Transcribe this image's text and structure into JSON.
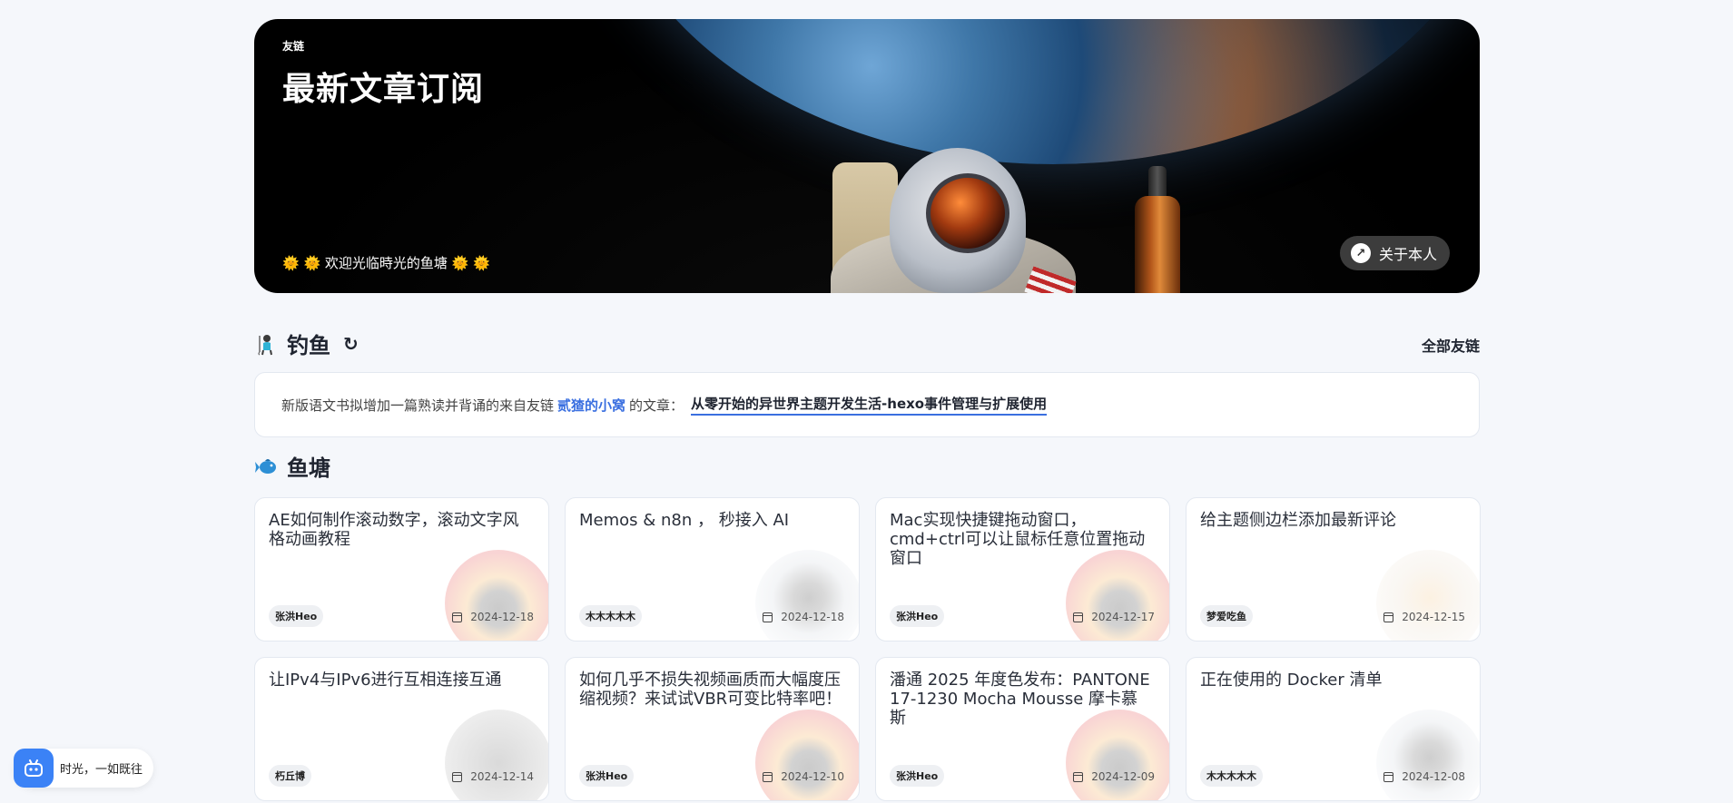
{
  "banner": {
    "small_label": "友链",
    "title": "最新文章订阅",
    "welcome": "🌞 🌞 欢迎光临時光的鱼塘 🌞 🌞",
    "about_button": "关于本人"
  },
  "fishing": {
    "heading": "钓鱼",
    "all_links": "全部友链",
    "notice_prefix": "新版语文书拟增加一篇熟读并背诵的来自友链",
    "notice_author": "贰猹的小窝",
    "notice_middle": "的文章：",
    "notice_article": "从零开始的异世界主题开发生活-hexo事件管理与扩展使用"
  },
  "pond": {
    "heading": "鱼塘",
    "cards": [
      {
        "title": "AE如何制作滚动数字，滚动文字风格动画教程",
        "author": "张洪Heo",
        "date": "2024-12-18",
        "avatar": "heo"
      },
      {
        "title": "Memos & n8n ， 秒接入 AI",
        "author": "木木木木木",
        "date": "2024-12-18",
        "avatar": "mu"
      },
      {
        "title": "Mac实现快捷键拖动窗口，cmd+ctrl可以让鼠标任意位置拖动窗口",
        "author": "张洪Heo",
        "date": "2024-12-17",
        "avatar": "heo"
      },
      {
        "title": "给主题侧边栏添加最新评论",
        "author": "梦爱吃鱼",
        "date": "2024-12-15",
        "avatar": "meng"
      },
      {
        "title": "让IPv4与IPv6进行互相连接互通",
        "author": "朽丘博",
        "date": "2024-12-14",
        "avatar": "xiu"
      },
      {
        "title": "如何几乎不损失视频画质而大幅度压缩视频？来试试VBR可变比特率吧！",
        "author": "张洪Heo",
        "date": "2024-12-10",
        "avatar": "heo"
      },
      {
        "title": "潘通 2025 年度色发布：PANTONE 17-1230 Mocha Mousse 摩卡慕斯",
        "author": "张洪Heo",
        "date": "2024-12-09",
        "avatar": "heo"
      },
      {
        "title": "正在使用的 Docker 清单",
        "author": "木木木木木",
        "date": "2024-12-08",
        "avatar": "mu"
      }
    ]
  },
  "widget": {
    "text": "时光，一如既往"
  },
  "colors": {
    "accent": "#3a6fe0",
    "widget_blue": "#3b82f6",
    "background": "#f5f7fb"
  },
  "icons": {
    "fishing": "fishing-person-icon",
    "refresh": "refresh-icon",
    "pond": "fish-icon",
    "about": "arrow-up-right-icon",
    "date": "calendar-icon",
    "widget": "robot-icon"
  }
}
